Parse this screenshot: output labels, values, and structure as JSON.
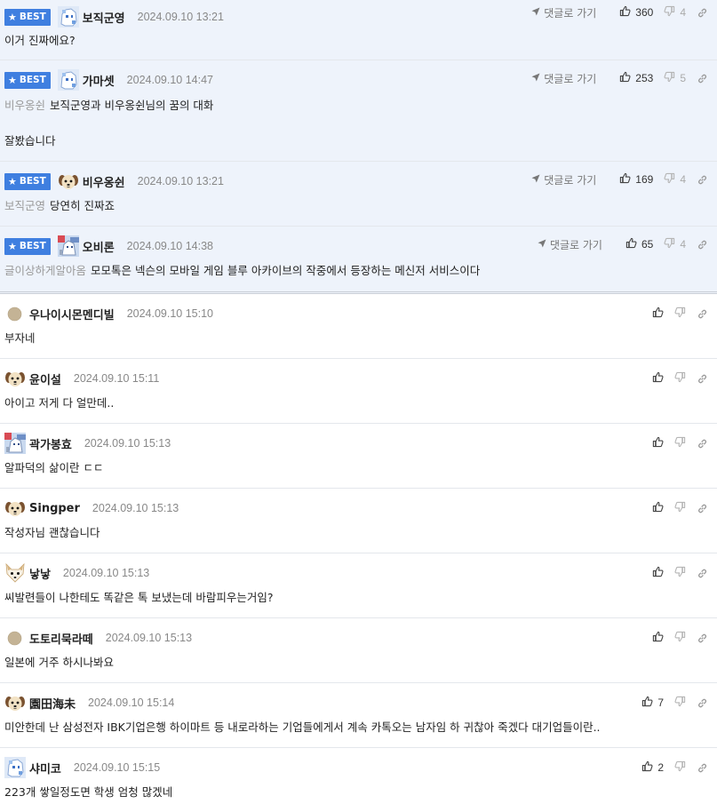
{
  "ui": {
    "best_label": "BEST",
    "reply_label": "댓글로 가기"
  },
  "best_comments": [
    {
      "nick": "보직군영",
      "date": "2024.09.10 13:21",
      "mention": "",
      "text": "이거 진짜에요?",
      "line2": "",
      "up": "360",
      "down": "4",
      "avatar": "pixel-blue"
    },
    {
      "nick": "가마셋",
      "date": "2024.09.10 14:47",
      "mention": "비우옹쉰",
      "text": "보직군영과 비우옹쉰님의 꿈의 대화",
      "line2": "잘봤습니다",
      "up": "253",
      "down": "5",
      "avatar": "pixel-blue"
    },
    {
      "nick": "비우옹쉰",
      "date": "2024.09.10 13:21",
      "mention": "보직군영",
      "text": "당연히 진짜죠",
      "line2": "",
      "up": "169",
      "down": "4",
      "avatar": "dog"
    },
    {
      "nick": "오비론",
      "date": "2024.09.10 14:38",
      "mention": "글이상하게알아옴",
      "text": "모모톡은 넥슨의 모바일 게임 블루 아카이브의 작중에서 등장하는 메신저 서비스이다",
      "line2": "",
      "up": "65",
      "down": "4",
      "avatar": "pixel-mix"
    }
  ],
  "comments": [
    {
      "nick": "우나이시몬멘디빌",
      "date": "2024.09.10 15:10",
      "text": "부자네",
      "up": "",
      "avatar": "dot"
    },
    {
      "nick": "윤이설",
      "date": "2024.09.10 15:11",
      "text": "아이고 저게 다 얼만데..",
      "up": "",
      "avatar": "dog"
    },
    {
      "nick": "곽가봉효",
      "date": "2024.09.10 15:13",
      "text": "알파덕의 삶이란 ㄷㄷ",
      "up": "",
      "avatar": "pixel-mix"
    },
    {
      "nick": "Singper",
      "date": "2024.09.10 15:13",
      "text": "작성자님 괜찮습니다",
      "up": "",
      "avatar": "dog"
    },
    {
      "nick": "낳낳",
      "date": "2024.09.10 15:13",
      "text": "씨발련들이 나한테도 똑같은 톡 보냈는데 바람피우는거임?",
      "up": "",
      "avatar": "fox"
    },
    {
      "nick": "도토리묵라떼",
      "date": "2024.09.10 15:13",
      "text": "일본에 거주 하시나봐요",
      "up": "",
      "avatar": "dot"
    },
    {
      "nick": "園田海未",
      "date": "2024.09.10 15:14",
      "text": "미안한데 난 삼성전자 IBK기업은행 하이마트 등 내로라하는 기업들에게서 계속 카톡오는 남자임 하 귀찮아 죽겠다 대기업들이란..",
      "up": "7",
      "avatar": "dog"
    },
    {
      "nick": "샤미코",
      "date": "2024.09.10 15:15",
      "text": "223개 쌓일정도면 학생 엄청 많겠네",
      "up": "2",
      "avatar": "pixel-blue"
    }
  ]
}
